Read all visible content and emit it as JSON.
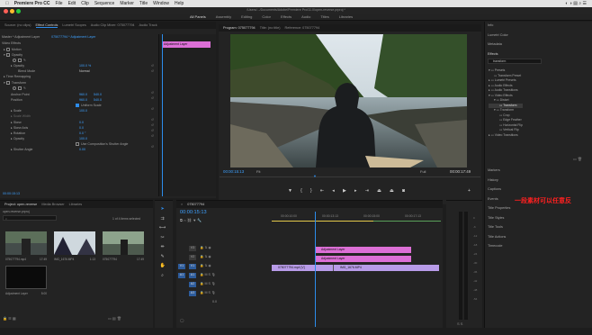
{
  "mac_menu": {
    "app": "Premiere Pro CC",
    "items": [
      "File",
      "Edit",
      "Clip",
      "Sequence",
      "Marker",
      "Title",
      "Window",
      "Help"
    ]
  },
  "window": {
    "path": "/Users/.../Documents/Adobe/Premiere Pro/11.0/open-reverse.prproj *"
  },
  "workspaces": [
    "All Panels",
    "Assembly",
    "Editing",
    "Color",
    "Effects",
    "Audio",
    "Titles",
    "Libraries"
  ],
  "source_tabs": [
    "Source: (no clips)",
    "Effect Controls",
    "Lumetri Scopes",
    "Audio Clip Mixer: 075077794",
    "Audio Track"
  ],
  "ec": {
    "crumb_master": "Master * Adjustment Layer",
    "crumb_seq": "075077794 * Adjustment Layer",
    "section": "Video Effects",
    "clip_label": "Adjustment Layer",
    "motion": "Motion",
    "opacity_group": "Opacity",
    "opacity_label": "Opacity",
    "opacity_val": "100.0 %",
    "blend_label": "Blend Mode",
    "blend_val": "Normal",
    "time_remap": "Time Remapping",
    "transform": "Transform",
    "anchor_label": "Anchor Point",
    "anchor_x": "960.0",
    "anchor_y": "540.0",
    "position_label": "Position",
    "position_x": "960.0",
    "position_y": "540.0",
    "uniform_label": "Uniform Scale",
    "scale_label": "Scale",
    "scale_val": "100.0",
    "scale_w_label": "Scale Width",
    "skew_label": "Skew",
    "skew_val": "0.0",
    "skew_axis_label": "Skew Axis",
    "skew_axis_val": "0.0",
    "rotation_label": "Rotation",
    "rotation_val": "0.0 °",
    "opacity2_label": "Opacity",
    "opacity2_val": "100.0",
    "comp_shutter": "Use Composition's Shutter Angle",
    "shutter_label": "Shutter Angle",
    "shutter_val": "0.00",
    "mini_clip": "Adjustment Layer",
    "timecode": "00:00:15:13"
  },
  "program": {
    "tabs": [
      "Program: 075077794",
      "Title: (no title)",
      "Reference: 075077794"
    ],
    "timecode": "00:00:15:13",
    "fit": "Fit",
    "quality": "Full",
    "duration": "00:00:17:49"
  },
  "project": {
    "tabs": [
      "Project: open-reverse",
      "Media Browser",
      "Libraries"
    ],
    "name": "open-reverse.prproj",
    "count": "1 of 4 items selected",
    "items": [
      {
        "name": "075077794.mp4",
        "dur": "17:49"
      },
      {
        "name": "IMG_1676.MP4",
        "dur": "1:13"
      },
      {
        "name": "075077794",
        "dur": "17:49"
      },
      {
        "name": "Adjustment Layer",
        "dur": "5:00"
      }
    ]
  },
  "timeline": {
    "tab": "075077794",
    "timecode": "00:00:15:13",
    "ruler": [
      "00:00:10:00",
      "00:00:13:13",
      "00:00:15:00",
      "00:00:17:13"
    ],
    "tracks_video": [
      "V3",
      "V2",
      "V1"
    ],
    "tracks_audio": [
      "A1",
      "A2",
      "A3"
    ],
    "clip_adj1": "Adjustment Layer",
    "clip_adj2": "Adjustment Layer",
    "clip_v1a": "075077794.mp4 [V]",
    "clip_v1b": "IMG_1676.MP4",
    "master_val": "0.0"
  },
  "right_panel": {
    "items": [
      "Info",
      "Lumetri Color",
      "Metadata",
      "Effects"
    ],
    "search_placeholder": "transform",
    "tree": [
      "Presets",
      "Transform Preset",
      "Lumetri Presets",
      "Audio Effects",
      "Audio Transitions",
      "Video Effects",
      "Distort",
      "Transform",
      "Transform",
      "Crop",
      "Edge Feather",
      "Horizontal Flip",
      "Vertical Flip",
      "Video Transitions"
    ],
    "lower": [
      "Markers",
      "History",
      "Captions",
      "Events",
      "Title Properties",
      "Title Styles",
      "Title Tools",
      "Title Actions",
      "Timecode"
    ]
  },
  "annotation": "一段素材可以任意反",
  "colors": {
    "accent": "#2d8ceb",
    "adj": "#dc6fd6",
    "v1": "#b89be8",
    "timecode": "#3ea1ff",
    "annotation": "#ff2020"
  }
}
